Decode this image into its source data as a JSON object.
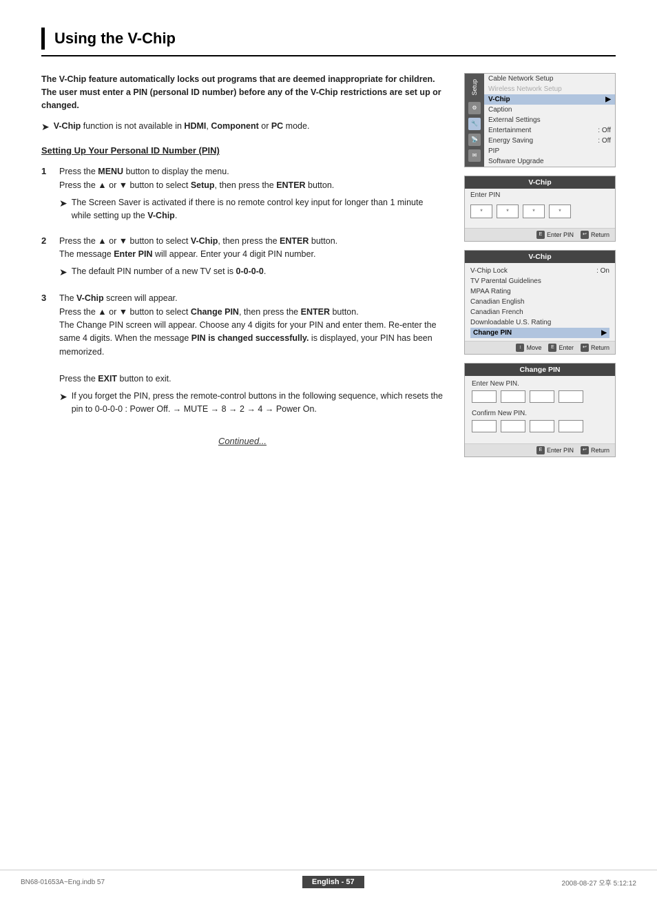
{
  "page": {
    "title": "Using the V-Chip",
    "intro": "The V-Chip feature automatically locks out programs that are deemed inappropriate for children. The user must enter a PIN (personal ID number) before any of the V-Chip restrictions are set up or changed.",
    "note1_prefix": "V-Chip",
    "note1_text": " function is not available in ",
    "note1_bold1": "HDMI",
    "note1_comma": ", ",
    "note1_bold2": "Component",
    "note1_or": " or ",
    "note1_bold3": "PC",
    "note1_suffix": " mode.",
    "section_heading": "Setting Up Your Personal ID Number (PIN)",
    "steps": [
      {
        "num": "1",
        "text1": "Press the ",
        "bold1": "MENU",
        "text2": " button to display the menu.",
        "text3": "Press the ▲ or ▼ button to select ",
        "bold2": "Setup",
        "text4": ", then press the ",
        "bold3": "ENTER",
        "text5": " button.",
        "note": "The Screen Saver is activated if there is no remote control key input for longer than 1 minute while setting up the V-Chip."
      },
      {
        "num": "2",
        "text1": "Press the ▲ or ▼ button to select ",
        "bold1": "V-Chip",
        "text2": ", then press the ",
        "bold2": "ENTER",
        "text3": " button.",
        "text4": "The message ",
        "bold3": "Enter PIN",
        "text5": " will appear. Enter your 4 digit PIN number.",
        "note": "The default PIN number of a new TV set is 0-0-0-0."
      },
      {
        "num": "3",
        "text1": "The ",
        "bold1": "V-Chip",
        "text2": " screen will appear.",
        "text3": "Press the ▲ or ▼ button to select ",
        "bold2": "Change PIN",
        "text4": ", then press the ",
        "bold3": "ENTER",
        "text5": " button.",
        "text6": "The Change PIN screen will appear. Choose any 4 digits for your PIN and enter them. Re-enter the same 4 digits. When the message ",
        "bold4": "PIN is changed successfully.",
        "text7": " is displayed, your PIN has been memorized.",
        "text8": "Press the ",
        "bold5": "EXIT",
        "text9": " button to exit.",
        "note": "If you forget the PIN, press the remote-control buttons in the following sequence, which resets the pin to 0-0-0-0 : Power Off. → MUTE → 8 → 2 → 4 → Power On."
      }
    ],
    "continued": "Continued...",
    "screenshots": {
      "screen1": {
        "title": "Setup",
        "items": [
          {
            "label": "Cable Network Setup",
            "highlight": false
          },
          {
            "label": "Wireless Network Setup",
            "highlight": false,
            "dim": true
          },
          {
            "label": "V-Chip",
            "highlight": true
          },
          {
            "label": "Caption",
            "highlight": false
          },
          {
            "label": "External Settings",
            "highlight": false
          },
          {
            "label": "Entertainment",
            "value": ": Off",
            "highlight": false
          },
          {
            "label": "Energy Saving",
            "value": ": Off",
            "highlight": false
          },
          {
            "label": "PIP",
            "highlight": false
          },
          {
            "label": "Software Upgrade",
            "highlight": false
          }
        ]
      },
      "screen2": {
        "title": "V-Chip",
        "enter_pin_label": "Enter PIN",
        "footer_enter": "Enter PIN",
        "footer_return": "Return"
      },
      "screen3": {
        "title": "V-Chip",
        "items": [
          {
            "label": "V-Chip Lock",
            "value": ": On",
            "highlight": false
          },
          {
            "label": "TV Parental Guidelines",
            "highlight": false
          },
          {
            "label": "MPAA Rating",
            "highlight": false
          },
          {
            "label": "Canadian English",
            "highlight": false
          },
          {
            "label": "Canadian French",
            "highlight": false
          },
          {
            "label": "Downloadable U.S. Rating",
            "highlight": false
          },
          {
            "label": "Change PIN",
            "highlight": true
          }
        ],
        "footer_move": "Move",
        "footer_enter": "Enter",
        "footer_return": "Return"
      },
      "screen4": {
        "title": "Change PIN",
        "enter_new_label": "Enter New PIN.",
        "confirm_new_label": "Confirm New PIN.",
        "footer_enter": "Enter PIN",
        "footer_return": "Return"
      }
    },
    "footer": {
      "left": "BN68-01653A~Eng.indb   57",
      "center": "English - 57",
      "right": "2008-08-27   오후 5:12:12"
    }
  }
}
